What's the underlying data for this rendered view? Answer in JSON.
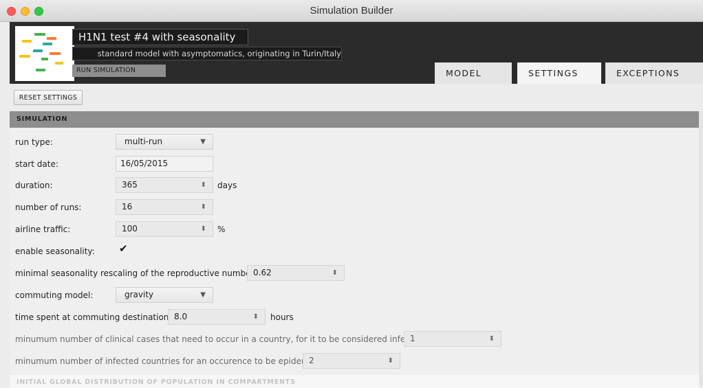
{
  "window": {
    "title": "Simulation Builder"
  },
  "header": {
    "title": "H1N1 test #4 with seasonality",
    "description": "standard model with asymptomatics, originating in Turin/Italy",
    "run_label": "RUN SIMULATION"
  },
  "tabs": [
    {
      "label": "MODEL",
      "active": false
    },
    {
      "label": "SETTINGS",
      "active": true
    },
    {
      "label": "EXCEPTIONS",
      "active": false
    }
  ],
  "toolbar": {
    "reset_label": "RESET SETTINGS"
  },
  "section": {
    "title": "SIMULATION"
  },
  "form": {
    "run_type": {
      "label": "run type:",
      "value": "multi-run"
    },
    "start_date": {
      "label": "start date:",
      "value": "16/05/2015"
    },
    "duration": {
      "label": "duration:",
      "value": "365",
      "unit": "days"
    },
    "number_of_runs": {
      "label": "number of runs:",
      "value": "16"
    },
    "airline_traffic": {
      "label": "airline traffic:",
      "value": "100",
      "unit": "%"
    },
    "enable_seasonality": {
      "label": "enable seasonality:",
      "checked": true,
      "glyph": "✔"
    },
    "min_seasonality": {
      "label": "minimal seasonality rescaling of the reproductive number:",
      "value": "0.62"
    },
    "commuting_model": {
      "label": "commuting model:",
      "value": "gravity"
    },
    "commuting_time": {
      "label": "time spent at commuting destination:",
      "value": "8.0",
      "unit": "hours"
    },
    "min_clinical_cases": {
      "label": "minumum number of clinical cases that need to occur in a country, for it to be considered infected:",
      "value": "1"
    },
    "min_infected_countries": {
      "label": "minumum number of infected countries for an occurence to be epidemic:",
      "value": "2"
    }
  },
  "next_section": {
    "title": "INITIAL GLOBAL DISTRIBUTION OF POPULATION IN COMPARTMENTS"
  },
  "icons": {
    "dropdown": "▼",
    "spinner": "⬍"
  },
  "colors": {
    "header_bg": "#2b2b2b",
    "section_bg": "#8d8d8d",
    "run_button": "#8e8e8e"
  }
}
